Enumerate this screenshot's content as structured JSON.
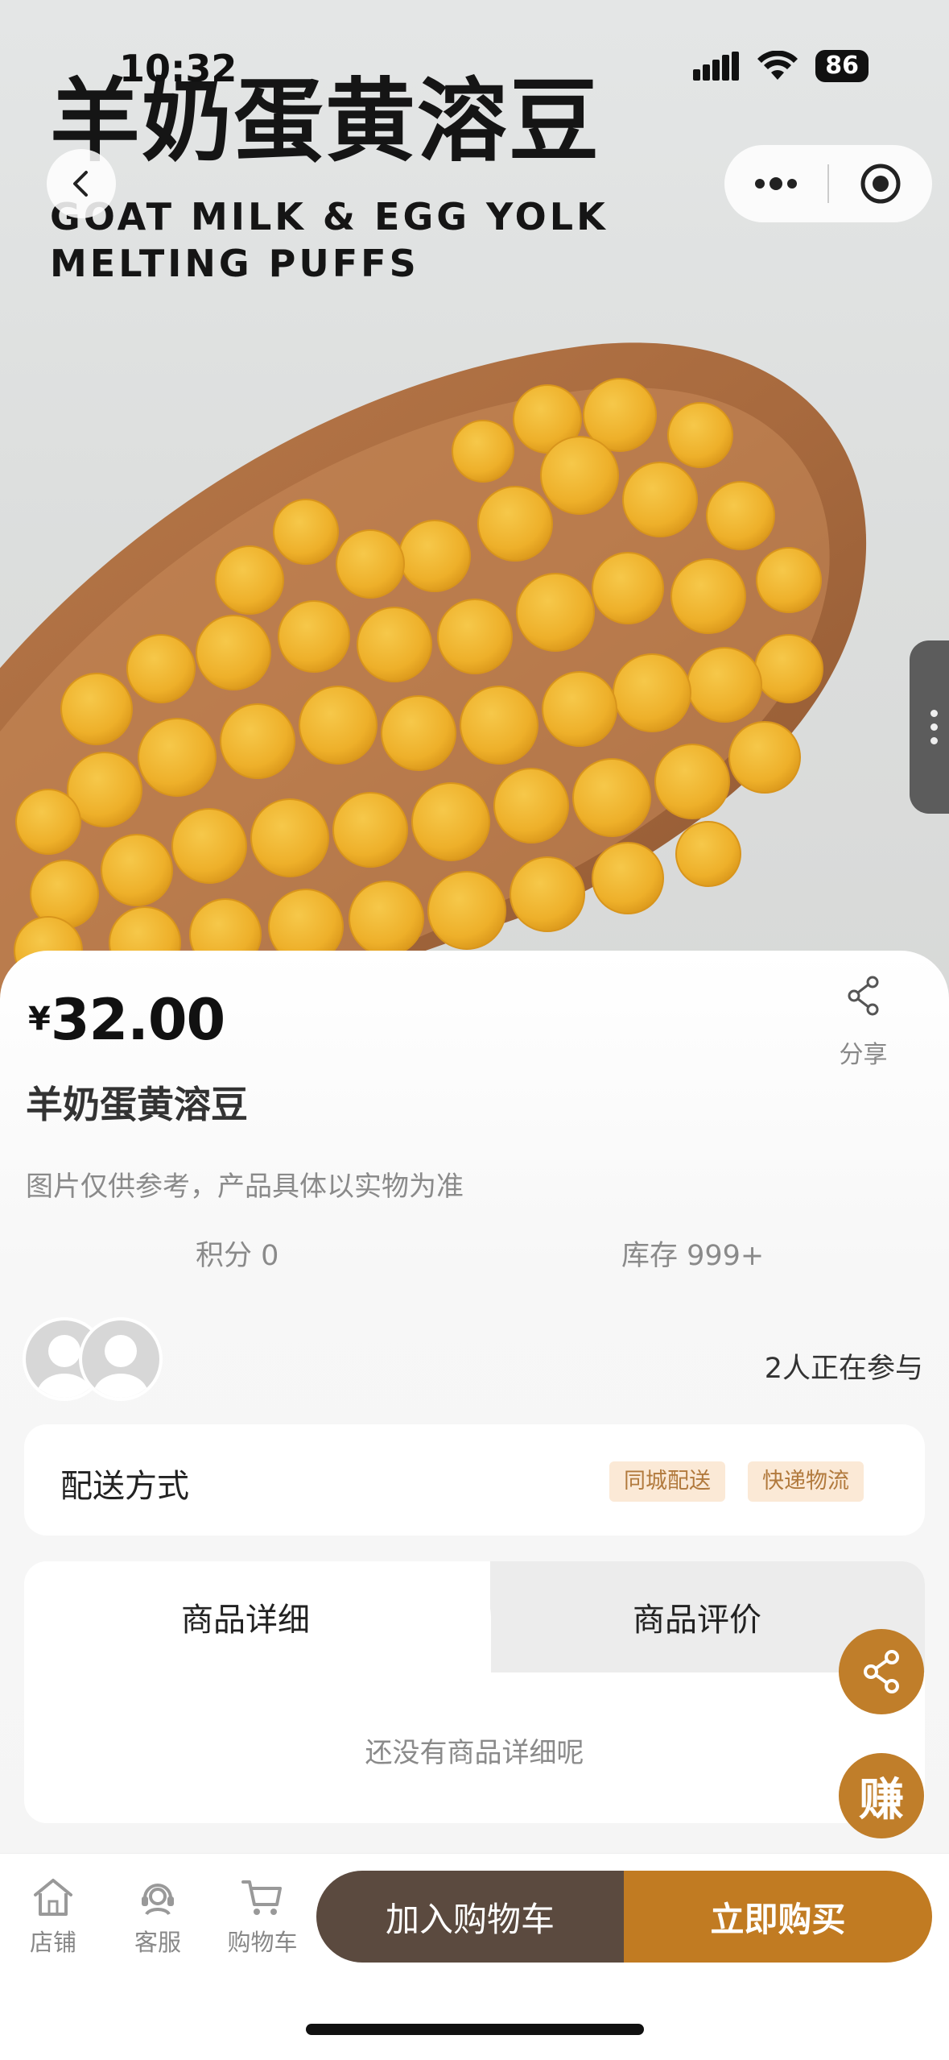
{
  "status_bar": {
    "time": "10:32",
    "battery": "86"
  },
  "hero": {
    "title_cn": "羊奶蛋黄溶豆",
    "title_en_line1": "GOAT MILK & EGG YOLK",
    "title_en_line2": "MELTING PUFFS"
  },
  "product": {
    "currency": "¥",
    "price": "32.00",
    "share_label": "分享",
    "name": "羊奶蛋黄溶豆",
    "note": "图片仅供参考，产品具体以实物为准",
    "points": "积分 0",
    "stock": "库存 999+",
    "participants": "2人正在参与"
  },
  "delivery": {
    "label": "配送方式",
    "tags": [
      "同城配送",
      "快递物流"
    ]
  },
  "tabs": {
    "details": "商品详细",
    "reviews": "商品评价",
    "empty_text": "还没有商品详细呢"
  },
  "float": {
    "earn": "赚"
  },
  "bottom_nav": {
    "store": "店铺",
    "service": "客服",
    "cart": "购物车",
    "add_to_cart": "加入购物车",
    "buy_now": "立即购买"
  },
  "colors": {
    "accent": "#c17b22",
    "dark_button": "#5b4a3f",
    "tag_bg": "#fbe9d6",
    "tag_text": "#b27a3d"
  },
  "icons": [
    "back-icon",
    "more-icon",
    "close-target-icon",
    "share-icon",
    "store-icon",
    "service-icon",
    "cart-icon"
  ]
}
